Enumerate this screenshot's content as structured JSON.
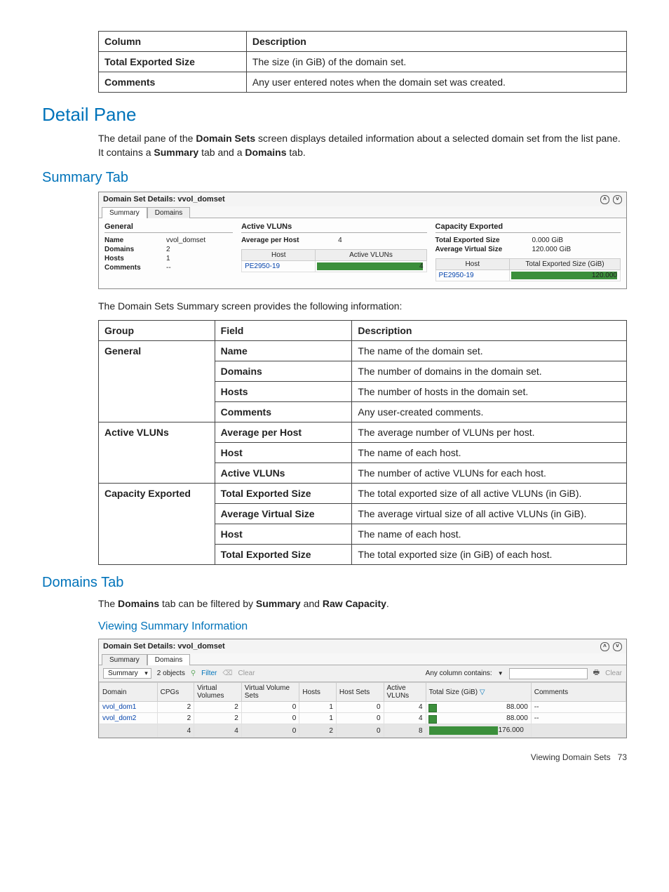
{
  "table1": {
    "headers": [
      "Column",
      "Description"
    ],
    "rows": [
      {
        "col": "Total Exported Size",
        "desc": "The size (in GiB) of the domain set."
      },
      {
        "col": "Comments",
        "desc": "Any user entered notes when the domain set was created."
      }
    ]
  },
  "headings": {
    "detail_pane": "Detail Pane",
    "summary_tab": "Summary Tab",
    "domains_tab": "Domains Tab",
    "viewing_summary": "Viewing Summary Information"
  },
  "para": {
    "detail_intro_1": "The detail pane of the ",
    "detail_intro_b1": "Domain Sets",
    "detail_intro_2": " screen displays detailed information about a selected domain set from the list pane. It contains a ",
    "detail_intro_b2": "Summary",
    "detail_intro_3": " tab and a ",
    "detail_intro_b3": "Domains",
    "detail_intro_4": " tab.",
    "summary_lead": "The Domain Sets Summary screen provides the following information:",
    "domains_lead_1": "The ",
    "domains_lead_b1": "Domains",
    "domains_lead_2": " tab can be filtered by ",
    "domains_lead_b2": "Summary",
    "domains_lead_3": " and ",
    "domains_lead_b3": "Raw Capacity",
    "domains_lead_4": "."
  },
  "panel1": {
    "title": "Domain Set Details: vvol_domset",
    "tabs": {
      "summary": "Summary",
      "domains": "Domains"
    },
    "general": {
      "heading": "General",
      "name_k": "Name",
      "name_v": "vvol_domset",
      "domains_k": "Domains",
      "domains_v": "2",
      "hosts_k": "Hosts",
      "hosts_v": "1",
      "comments_k": "Comments",
      "comments_v": "--"
    },
    "active": {
      "heading": "Active VLUNs",
      "avg_k": "Average per Host",
      "avg_v": "4",
      "th_host": "Host",
      "th_av": "Active VLUNs",
      "row_host": "PE2950-19",
      "row_val": "4"
    },
    "capacity": {
      "heading": "Capacity Exported",
      "tes_k": "Total Exported Size",
      "tes_v": "0.000 GiB",
      "avs_k": "Average Virtual Size",
      "avs_v": "120.000 GiB",
      "th_host": "Host",
      "th_size": "Total Exported Size (GiB)",
      "row_host": "PE2950-19",
      "row_val": "120.000"
    }
  },
  "table2": {
    "headers": [
      "Group",
      "Field",
      "Description"
    ],
    "rows": [
      {
        "group": "General",
        "field": "Name",
        "desc": "The name of the domain set.",
        "firstOfGroup": true,
        "groupRowspan": 4
      },
      {
        "group": "",
        "field": "Domains",
        "desc": "The number of domains in the domain set."
      },
      {
        "group": "",
        "field": "Hosts",
        "desc": "The number of hosts in the domain set."
      },
      {
        "group": "",
        "field": "Comments",
        "desc": "Any user-created comments."
      },
      {
        "group": "Active VLUNs",
        "field": "Average per Host",
        "desc": "The average number of VLUNs per host.",
        "firstOfGroup": true,
        "groupRowspan": 3
      },
      {
        "group": "",
        "field": "Host",
        "desc": "The name of each host."
      },
      {
        "group": "",
        "field": "Active VLUNs",
        "desc": "The number of active VLUNs for each host."
      },
      {
        "group": "Capacity Exported",
        "field": "Total Exported Size",
        "desc": "The total exported size of all active VLUNs (in GiB).",
        "firstOfGroup": true,
        "groupRowspan": 4
      },
      {
        "group": "",
        "field": "Average Virtual Size",
        "desc": "The average virtual size of all active VLUNs (in GiB)."
      },
      {
        "group": "",
        "field": "Host",
        "desc": "The name of each host."
      },
      {
        "group": "",
        "field": "Total Exported Size",
        "desc": "The total exported size (in GiB) of each host."
      }
    ]
  },
  "panel2": {
    "title": "Domain Set Details: vvol_domset",
    "tabs": {
      "summary": "Summary",
      "domains": "Domains"
    },
    "toolbar": {
      "dropdown": "Summary",
      "objects": "2 objects",
      "filter": "Filter",
      "clear1": "Clear",
      "any_col": "Any column contains:",
      "clear2": "Clear"
    },
    "headers": [
      "Domain",
      "CPGs",
      "Virtual Volumes",
      "Virtual Volume Sets",
      "Hosts",
      "Host Sets",
      "Active VLUNs",
      "Total Size (GiB)",
      "Comments"
    ],
    "rows": [
      {
        "domain": "vvol_dom1",
        "cpgs": "2",
        "vv": "2",
        "vvs": "0",
        "hosts": "1",
        "hs": "0",
        "av": "4",
        "size": "88.000",
        "comments": "--"
      },
      {
        "domain": "vvol_dom2",
        "cpgs": "2",
        "vv": "2",
        "vvs": "0",
        "hosts": "1",
        "hs": "0",
        "av": "4",
        "size": "88.000",
        "comments": "--"
      }
    ],
    "totals": {
      "cpgs": "4",
      "vv": "4",
      "vvs": "0",
      "hosts": "2",
      "hs": "0",
      "av": "8",
      "size": "176.000"
    }
  },
  "footer": {
    "text": "Viewing Domain Sets",
    "page": "73"
  },
  "chart_data": [
    {
      "type": "bar",
      "title": "Active VLUNs per Host",
      "categories": [
        "PE2950-19"
      ],
      "values": [
        4
      ],
      "xlabel": "Host",
      "ylabel": "Active VLUNs"
    },
    {
      "type": "bar",
      "title": "Total Exported Size per Host (GiB)",
      "categories": [
        "PE2950-19"
      ],
      "values": [
        120.0
      ],
      "xlabel": "Host",
      "ylabel": "Total Exported Size (GiB)"
    },
    {
      "type": "bar",
      "title": "Total Size (GiB) by Domain",
      "categories": [
        "vvol_dom1",
        "vvol_dom2"
      ],
      "values": [
        88.0,
        88.0
      ],
      "xlabel": "Domain",
      "ylabel": "Total Size (GiB)",
      "total": 176.0
    }
  ]
}
